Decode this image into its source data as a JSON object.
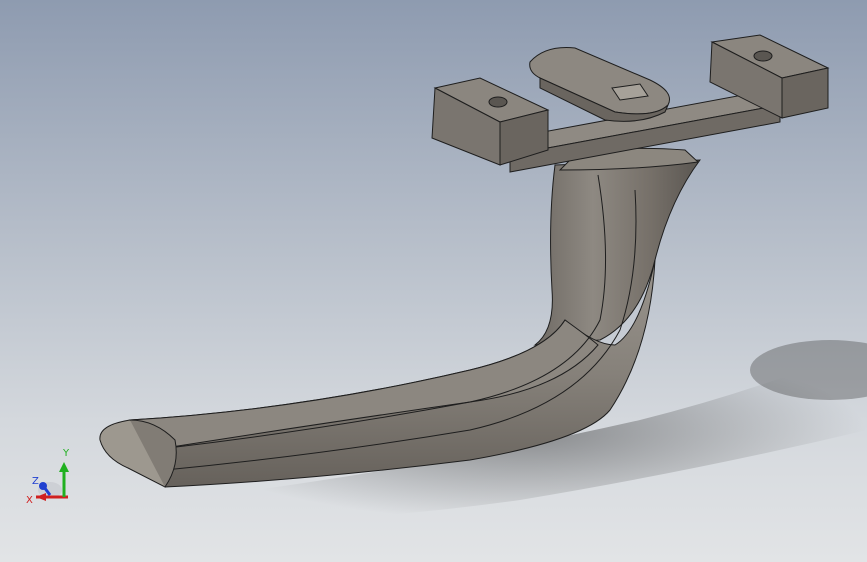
{
  "viewport": {
    "background_top": "#8e9bb0",
    "background_bottom": "#e2e4e6"
  },
  "model": {
    "color_light": "#8f8a83",
    "color_mid": "#7a756f",
    "color_dark": "#5e5a55",
    "edge_color": "#1e1e1e"
  },
  "triad": {
    "x_label": "X",
    "y_label": "Y",
    "z_label": "Z",
    "x_color": "#d02020",
    "y_color": "#20b020",
    "z_color": "#2040d0",
    "icon": "coordinate-triad-icon"
  }
}
